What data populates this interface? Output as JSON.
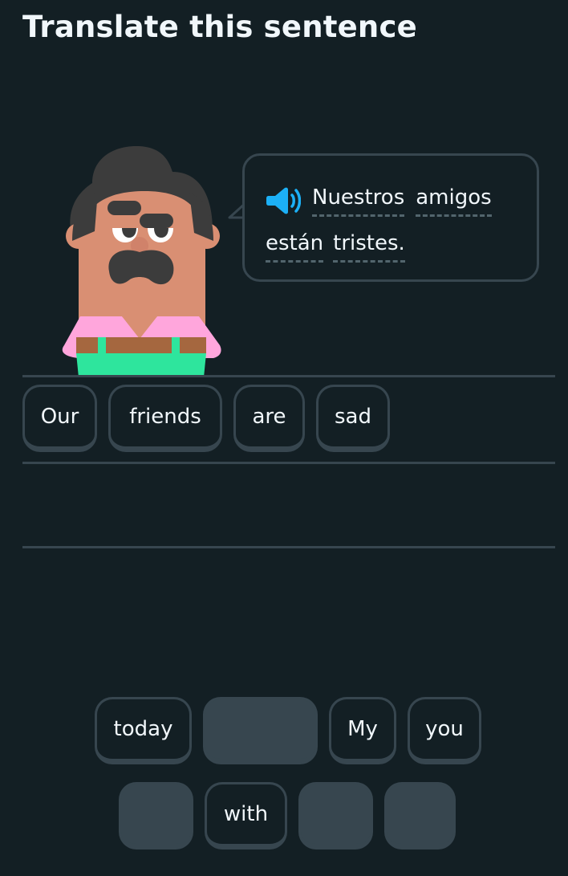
{
  "header": {
    "title": "Translate this sentence"
  },
  "prompt": {
    "speaker_icon": "speaker-icon",
    "line1": [
      "Nuestros",
      "amigos"
    ],
    "line2": [
      "están",
      "tristes."
    ],
    "accent_color": "#1cb0f6"
  },
  "answer": {
    "words": [
      "Our",
      "friends",
      "are",
      "sad"
    ]
  },
  "word_bank": {
    "row1": [
      {
        "label": "today",
        "used": false
      },
      {
        "label": "",
        "used": true
      },
      {
        "label": "My",
        "used": false
      },
      {
        "label": "you",
        "used": false
      }
    ],
    "row2": [
      {
        "label": "",
        "used": true
      },
      {
        "label": "with",
        "used": false
      },
      {
        "label": "",
        "used": true
      },
      {
        "label": "",
        "used": true
      }
    ]
  },
  "colors": {
    "background": "#131f24",
    "border": "#37464f",
    "text": "#f1f7fb"
  }
}
